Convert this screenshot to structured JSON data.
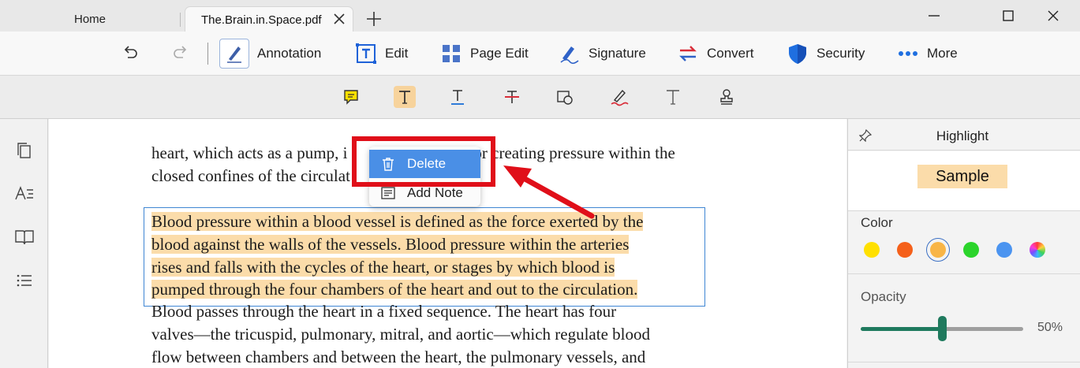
{
  "tabs": {
    "home": "Home",
    "active": "The.Brain.in.Space.pdf"
  },
  "toolbar": {
    "annotation": "Annotation",
    "edit": "Edit",
    "page_edit": "Page Edit",
    "signature": "Signature",
    "convert": "Convert",
    "security": "Security",
    "more": "More"
  },
  "document": {
    "para1": [
      "heart, which acts as a pump, i",
      "or creating pressure within the",
      "closed confines of the circulat"
    ],
    "para2": [
      "Blood pressure within a blood vessel is defined as the force exerted by the",
      "blood against the walls of the vessels. Blood pressure within the arteries",
      "rises and falls with the cycles of the heart, or stages by which blood is",
      "pumped through the four chambers of the heart and out to the circulation."
    ],
    "para3": [
      "Blood passes through the heart in a fixed sequence. The heart has four",
      "valves—the tricuspid, pulmonary, mitral, and aortic—which regulate blood",
      "flow between chambers and between the heart, the pulmonary vessels, and"
    ]
  },
  "context_menu": {
    "delete": "Delete",
    "add_note": "Add Note"
  },
  "panel": {
    "title": "Highlight",
    "sample": "Sample",
    "color_label": "Color",
    "opacity_label": "Opacity",
    "opacity_value": "50%",
    "opacity_fraction": 0.5,
    "colors": [
      "#ffe000",
      "#f5601a",
      "#f8b547",
      "#2bd42b",
      "#4b94f0",
      "rainbow"
    ],
    "selected_color_index": 2
  },
  "accent": {
    "highlight": "#fbdcaa",
    "selection": "#3f86d3",
    "callout": "#e00f19",
    "slider": "#1f7a5e"
  }
}
